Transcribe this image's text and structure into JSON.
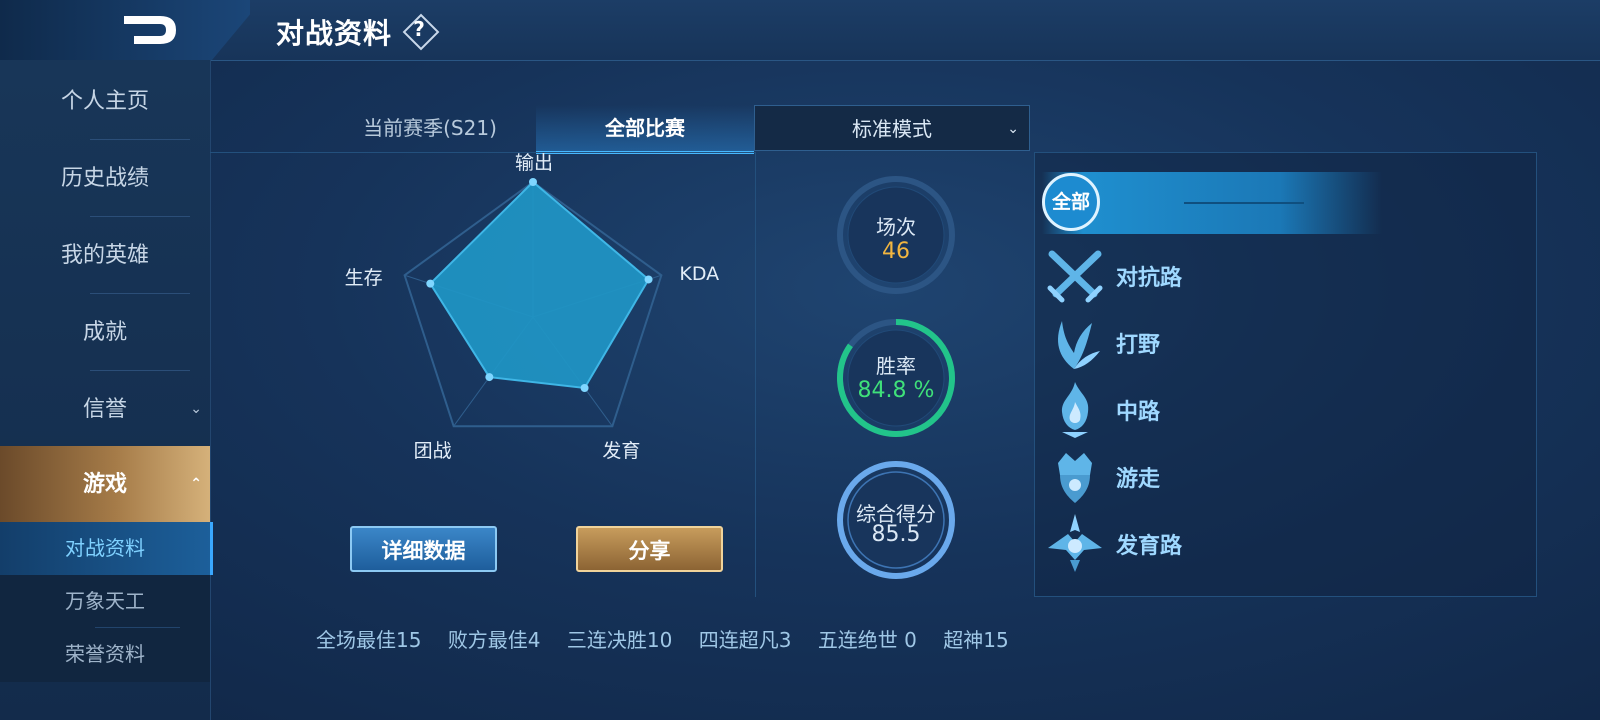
{
  "header": {
    "title": "对战资料",
    "help_label": "?"
  },
  "sidebar": {
    "items": [
      {
        "label": "个人主页"
      },
      {
        "label": "历史战绩"
      },
      {
        "label": "我的英雄"
      },
      {
        "label": "成就"
      },
      {
        "label": "信誉"
      },
      {
        "label": "游戏"
      }
    ],
    "sub_items": [
      {
        "label": "对战资料"
      },
      {
        "label": "万象天工"
      },
      {
        "label": "荣誉资料"
      }
    ]
  },
  "tabs": {
    "season": "当前赛季(S21)",
    "all_matches": "全部比赛",
    "mode": "标准模式"
  },
  "radar": {
    "labels": [
      "输出",
      "KDA",
      "发育",
      "团战",
      "生存"
    ],
    "values": [
      1.0,
      0.9,
      0.65,
      0.55,
      0.8
    ]
  },
  "buttons": {
    "detail": "详细数据",
    "share": "分享"
  },
  "stats": {
    "games": {
      "label": "场次",
      "value": "46"
    },
    "winrate": {
      "label": "胜率",
      "value": "84.8 %",
      "fraction": 0.848
    },
    "score": {
      "label": "综合得分",
      "value": "85.5"
    }
  },
  "lanes": {
    "all": "全部",
    "items": [
      {
        "label": "对抗路"
      },
      {
        "label": "打野"
      },
      {
        "label": "中路"
      },
      {
        "label": "游走"
      },
      {
        "label": "发育路"
      }
    ]
  },
  "bottom_stats": [
    "全场最佳15",
    "败方最佳4",
    "三连决胜10",
    "四连超凡3",
    "五连绝世 0",
    "超神15"
  ],
  "colors": {
    "accent": "#46b8ff",
    "gold": "#f2b640",
    "green": "#3fe07a",
    "lane_text": "#9fd8ff"
  }
}
